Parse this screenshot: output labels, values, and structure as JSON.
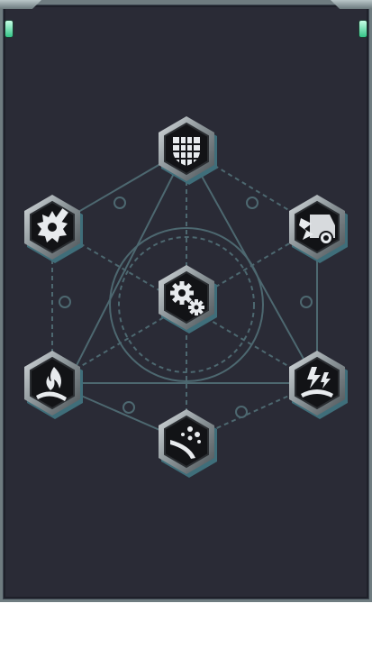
{
  "colors": {
    "panel_bg": "#2a2b36",
    "frame": "#6f7c80",
    "lines": "#4d6870",
    "hex_fill": "#121316",
    "hex_rim_light": "#c9cfd2",
    "hex_rim_dark": "#5a6165",
    "hex_shadow": "#3f6e7a",
    "icon": "#e8ebee",
    "gem": "#35c488"
  },
  "tree": {
    "nodes": [
      {
        "id": "core",
        "icon": "gears-icon"
      },
      {
        "id": "top",
        "icon": "grid-shield-icon"
      },
      {
        "id": "upper-left",
        "icon": "sawblade-icon"
      },
      {
        "id": "upper-right",
        "icon": "vehicle-impact-icon"
      },
      {
        "id": "lower-left",
        "icon": "fire-icon"
      },
      {
        "id": "lower-right",
        "icon": "lightning-icon"
      },
      {
        "id": "bottom",
        "icon": "debris-icon"
      }
    ]
  }
}
